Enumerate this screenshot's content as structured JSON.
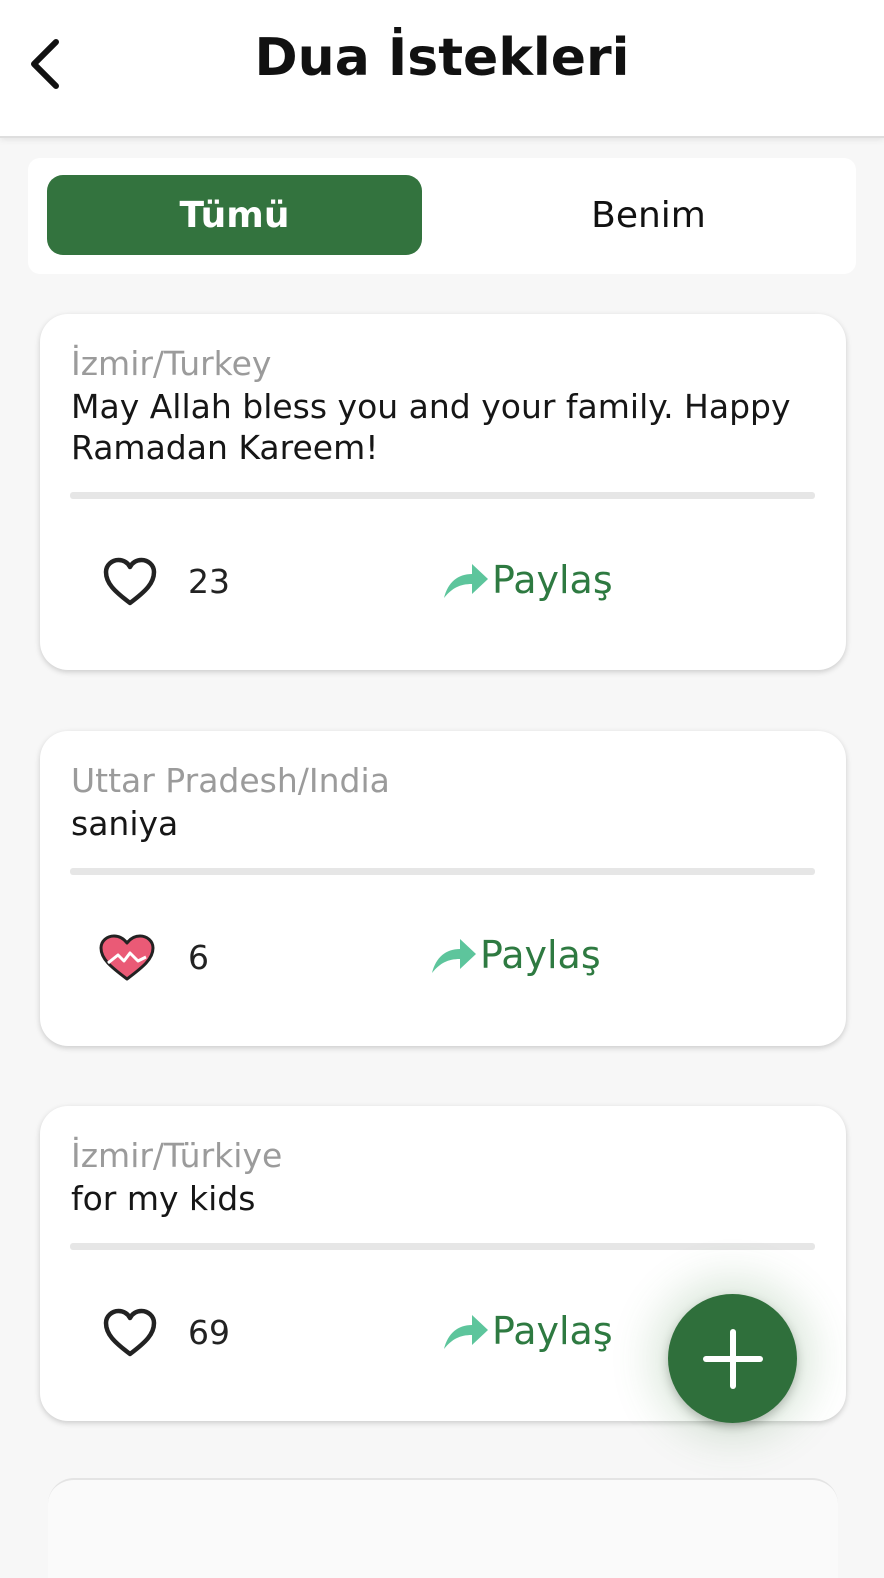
{
  "header": {
    "title": "Dua İstekleri"
  },
  "tabs": [
    {
      "label": "Tümü",
      "active": true
    },
    {
      "label": "Benim",
      "active": false
    }
  ],
  "accent_color": "#33733e",
  "share_color": "#2e7a41",
  "share_icon_color": "#5dc59c",
  "posts": [
    {
      "location": "İzmir/Turkey",
      "message": "May Allah bless you and your family. Happy Ramadan Kareem!",
      "likes": "23",
      "liked": false,
      "share_label": "Paylaş"
    },
    {
      "location": "Uttar Pradesh/India",
      "message": "saniya",
      "likes": "6",
      "liked": true,
      "share_label": "Paylaş"
    },
    {
      "location": "İzmir/Türkiye",
      "message": "for my kids",
      "likes": "69",
      "liked": false,
      "share_label": "Paylaş"
    }
  ],
  "icons": {
    "back": "chevron-left-icon",
    "like": "heart-icon",
    "liked": "heart-filled-icon",
    "share": "share-arrow-icon",
    "add": "plus-icon"
  }
}
